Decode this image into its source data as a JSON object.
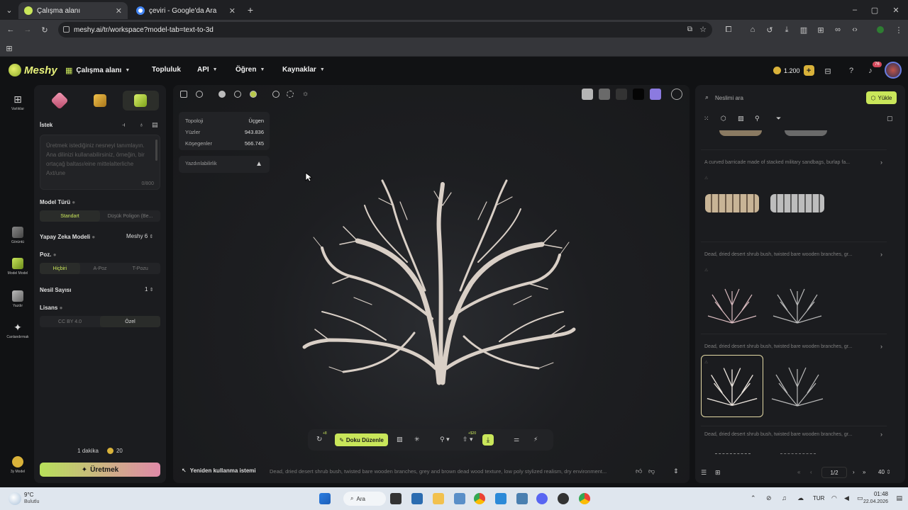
{
  "browser": {
    "tabs": [
      {
        "label": "Çalışma alanı",
        "active": true
      },
      {
        "label": "çeviri - Google'da Ara",
        "active": false
      }
    ],
    "new_tab": "+",
    "url": "meshy.ai/tr/workspace?model-tab=text-to-3d",
    "window_controls": {
      "minimize": "–",
      "maximize": "▢",
      "close": "✕"
    }
  },
  "app": {
    "logo": "Meshy",
    "nav": {
      "workspace": "Çalışma alanı",
      "community": "Topluluk",
      "api": "API",
      "learn": "Öğren",
      "resources": "Kaynaklar"
    },
    "credits": "1.200",
    "notif_badge": "76"
  },
  "rail": {
    "items": [
      {
        "label": "Varlıklar"
      },
      {
        "label": "Görüntü"
      },
      {
        "label": "Model Model"
      },
      {
        "label": "Yazdır"
      },
      {
        "label": "Canlandırmak"
      }
    ],
    "bottom": "3y Model"
  },
  "left": {
    "prompt_label": "İstek",
    "prompt_placeholder": "Üretmek istediğiniz nesneyi tanımlayın. Ana dilinizi kullanabilirsiniz, örneğin, bir ortaçağ baltası/eine mittelalterliche Axt/une",
    "char_count": "0/800",
    "model_type_label": "Model Türü",
    "model_type_opts": [
      "Standart",
      "Düşük Poligon (Be..."
    ],
    "ai_model_label": "Yapay Zeka Modeli",
    "ai_model_value": "Meshy 6",
    "pose_label": "Poz.",
    "pose_opts": [
      "Hiçbiri",
      "A-Poz",
      "T-Pozu"
    ],
    "gen_count_label": "Nesil Sayısı",
    "gen_count_value": "1",
    "license_label": "Lisans",
    "license_opts": [
      "CC BY 4.0",
      "Özel"
    ],
    "time": "1 dakika",
    "cost": "20",
    "generate": "Üretmek"
  },
  "viewport": {
    "stats": {
      "topology_label": "Topoloji",
      "topology_value": "Üçgen",
      "faces_label": "Yüzler",
      "faces_value": "943.836",
      "vertices_label": "Köşegenler",
      "vertices_value": "566.745"
    },
    "printability": "Yazdırılabilirlik",
    "toolbar": {
      "retexture": "Doku Düzenle",
      "badge_a": "+8",
      "badge_b": "+$20"
    },
    "reuse_prompt_label": "Yeniden kullanma istemi",
    "reuse_prompt_text": "Dead, dried desert shrub bush, twisted bare wooden branches, grey and brown dead wood texture, low poly stylized realism, dry environment..."
  },
  "right": {
    "search_placeholder": "Neslimi ara",
    "upload": "Yükle",
    "cards": [
      {
        "title": "A curved barricade made of stacked military sandbags, burlap fa..."
      },
      {
        "title": "Dead, dried desert shrub bush, twisted bare wooden branches, gr..."
      },
      {
        "title": "Dead, dried desert shrub bush, twisted bare wooden branches, gr..."
      },
      {
        "title": "Dead, dried desert shrub bush, twisted bare wooden branches, gr..."
      }
    ],
    "pagination": {
      "page": "1/2",
      "per_page": "40"
    }
  },
  "taskbar": {
    "weather_temp": "9°C",
    "weather_text": "Bulutlu",
    "search": "Ara",
    "lang": "TUR",
    "time": "01:48",
    "date": "22.04.2026"
  },
  "colors": {
    "accent": "#c9e65a",
    "generate_gradient_a": "#b7e05a",
    "generate_gradient_b": "#e08aa8"
  }
}
